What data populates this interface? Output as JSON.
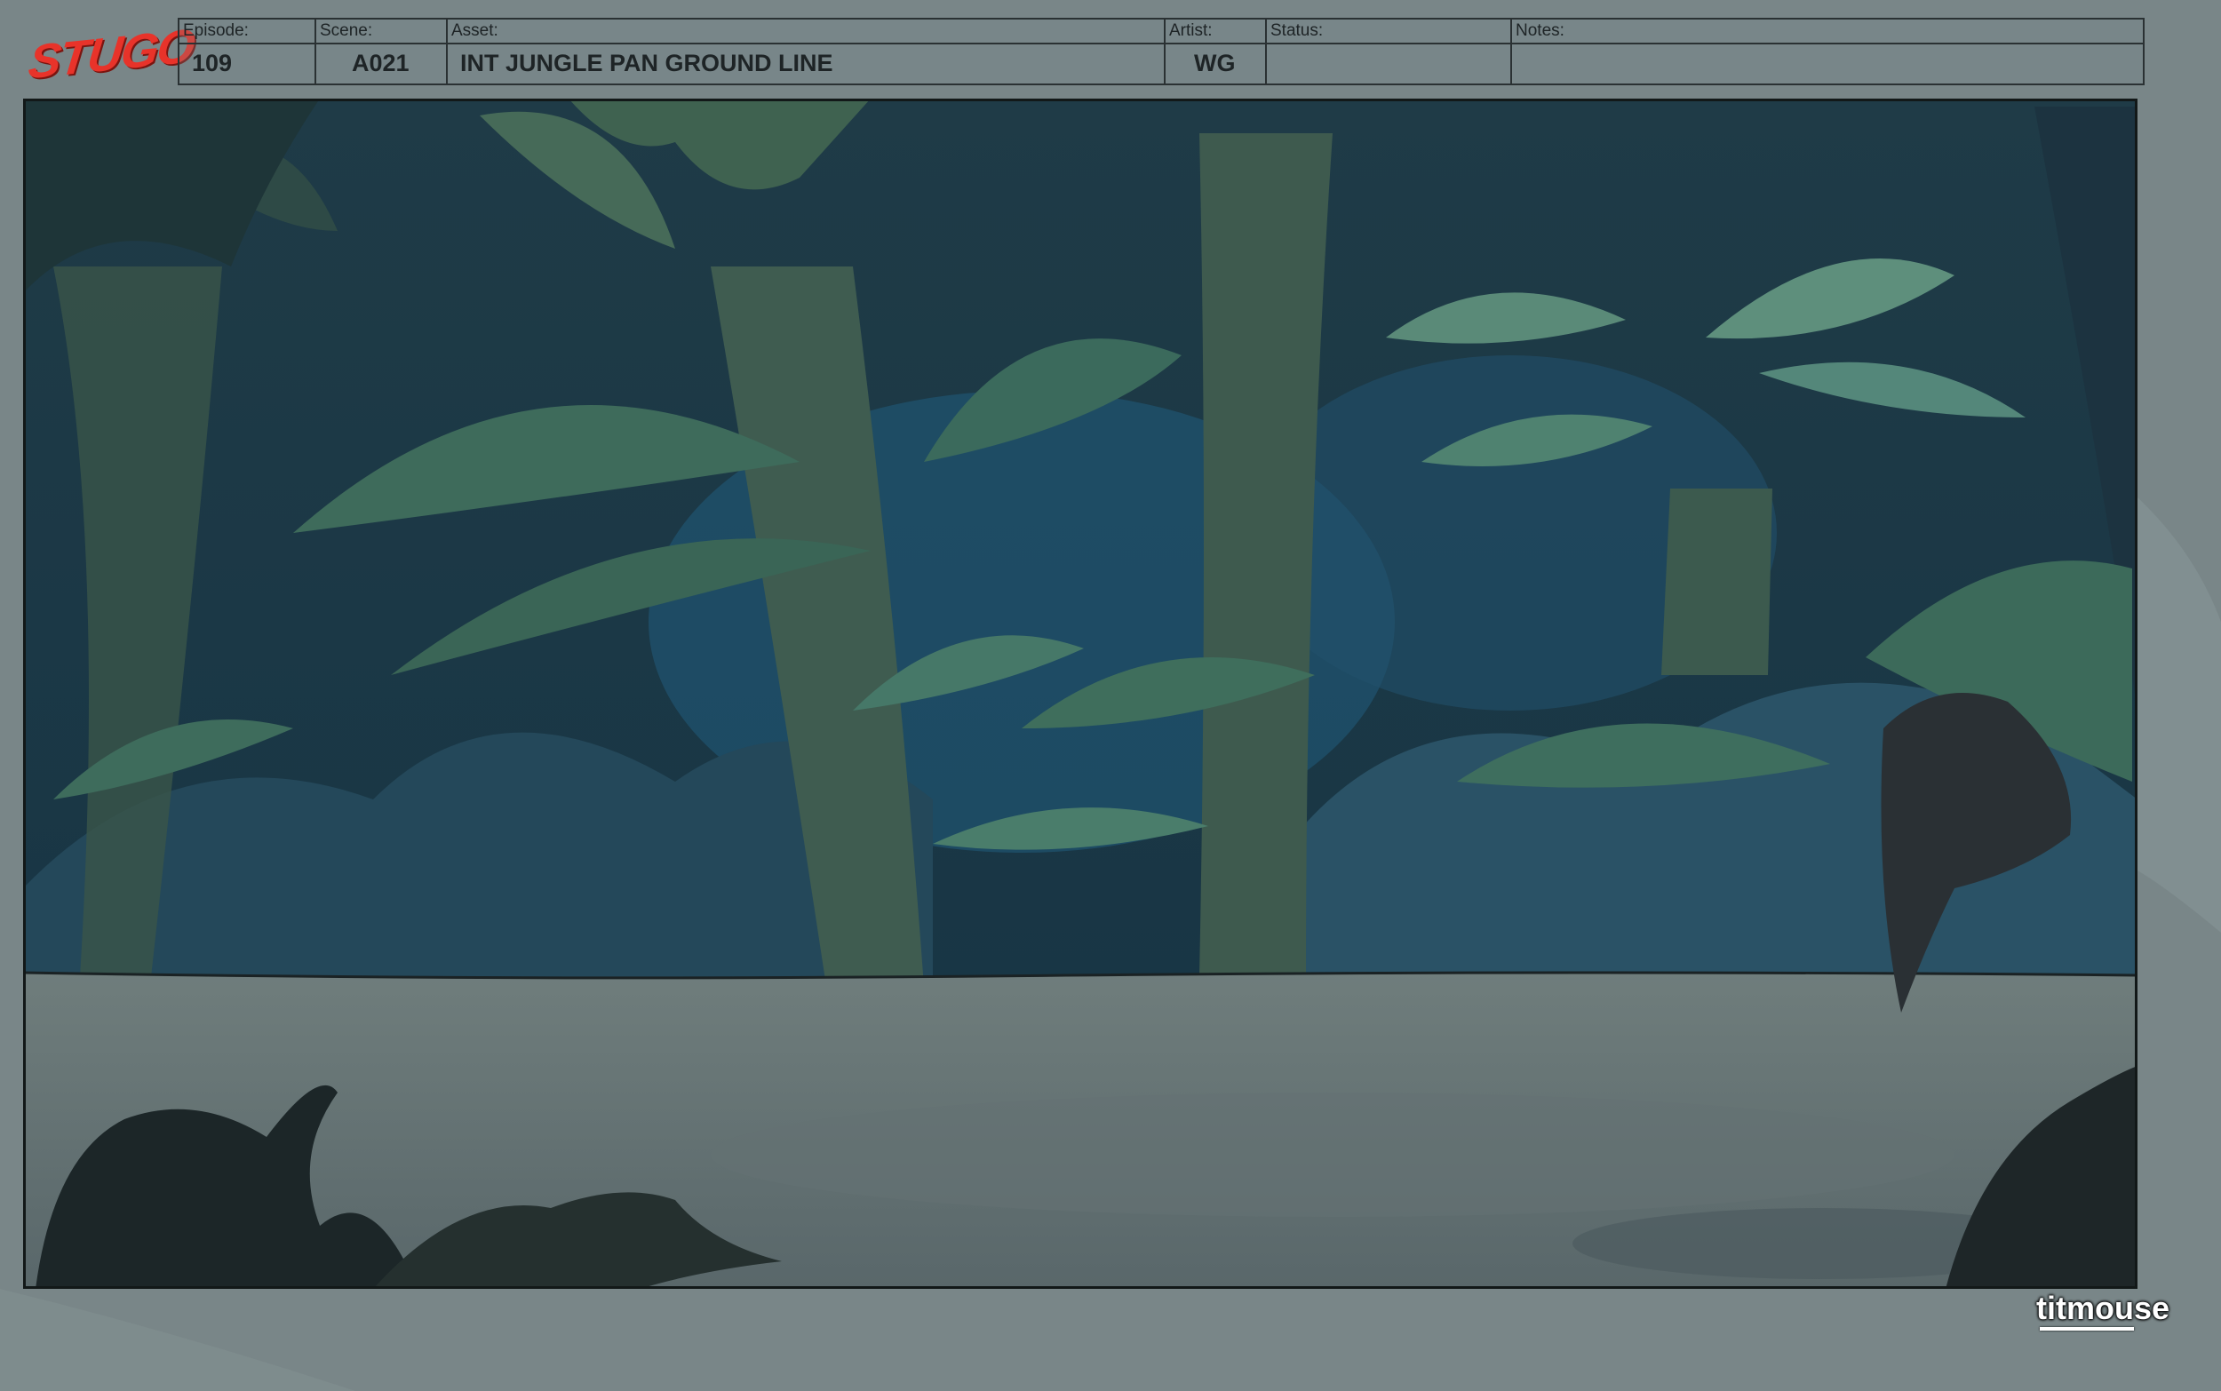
{
  "brand_logo": "STUGO",
  "header": {
    "episode_label": "Episode:",
    "episode_value": "109",
    "scene_label": "Scene:",
    "scene_value": "A021",
    "asset_label": "Asset:",
    "asset_value": "INT JUNGLE PAN GROUND LINE",
    "artist_label": "Artist:",
    "artist_value": "WG",
    "status_label": "Status:",
    "status_value": "",
    "notes_label": "Notes:",
    "notes_value": ""
  },
  "studio_logo": "titmouse",
  "colors": {
    "logo_red": "#e8332a",
    "border": "#121818",
    "overlay_gray": "#7d8a8d",
    "jungle_dark": "#1e3a48",
    "foliage_green": "#3f6e5c"
  }
}
